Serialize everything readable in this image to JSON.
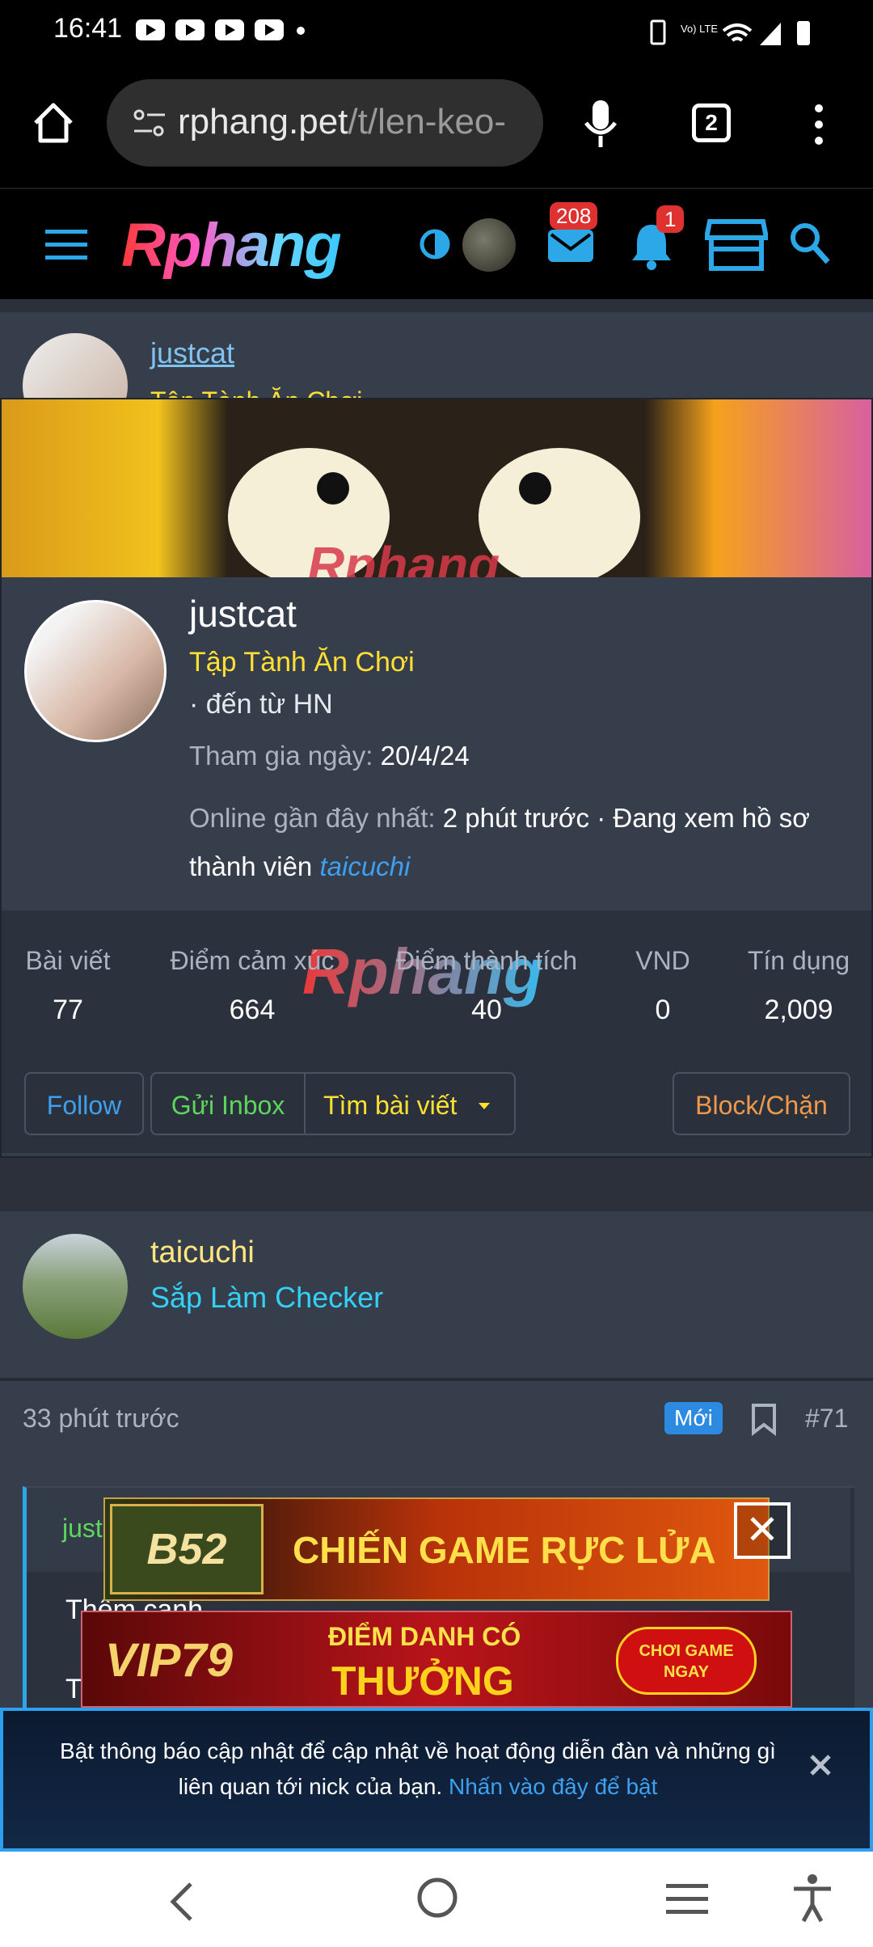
{
  "status_bar": {
    "time": "16:41"
  },
  "browser": {
    "url_host": "rphang.pet",
    "url_path": "/t/len-keo-",
    "tab_count": "2"
  },
  "forum_header": {
    "logo": "Rphang",
    "inbox_count": "208",
    "alert_count": "1"
  },
  "post_header": {
    "username": "justcat",
    "user_title": "Tập Tành Ăn Chơi"
  },
  "profile": {
    "name": "justcat",
    "title": "Tập Tành Ăn Chơi",
    "location": "· đến từ HN",
    "joined_label": "Tham gia ngày:",
    "joined_value": "20/4/24",
    "online_label": "Online gần đây nhất:",
    "online_value": "2 phút trước · Đang xem hồ sơ thành viên",
    "online_link": "taicuchi",
    "banner_watermark": "Rphang",
    "stats_watermark": "Rphang",
    "stats": [
      {
        "label": "Bài viết",
        "value": "77"
      },
      {
        "label": "Điểm cảm xúc",
        "value": "664"
      },
      {
        "label": "Điểm thành tích",
        "value": "40"
      },
      {
        "label": "VND",
        "value": "0"
      },
      {
        "label": "Tín dụng",
        "value": "2,009"
      }
    ],
    "buttons": {
      "follow": "Follow",
      "inbox": "Gửi Inbox",
      "find_posts": "Tìm bài viết",
      "block": "Block/Chặn"
    }
  },
  "post2": {
    "username": "taicuchi",
    "user_title": "Sắp Làm Checker",
    "time": "33 phút trước",
    "new_badge": "Mới",
    "post_number": "#71",
    "quote_author": "just",
    "quote_line1": "Thêm cạnh",
    "quote_line2": "T"
  },
  "ads": {
    "ad1_brand": "B52",
    "ad1_text": "CHIẾN GAME RỰC LỬA",
    "ad2_brand": "VIP79",
    "ad2_text_top": "ĐIỂM DANH CÓ",
    "ad2_text_bottom": "THƯỞNG",
    "ad2_cta": "CHƠI GAME NGAY"
  },
  "notification": {
    "text": "Bật thông báo cập nhật để cập nhật về hoạt động diễn đàn và những gì liên quan tới nick của bạn.",
    "link": "Nhấn vào đây để bật"
  },
  "colors": {
    "gold": "#ffe033",
    "cyan": "#33d1f5",
    "link": "#3ea0ef",
    "green": "#5cd65c",
    "orange": "#f0994a"
  }
}
